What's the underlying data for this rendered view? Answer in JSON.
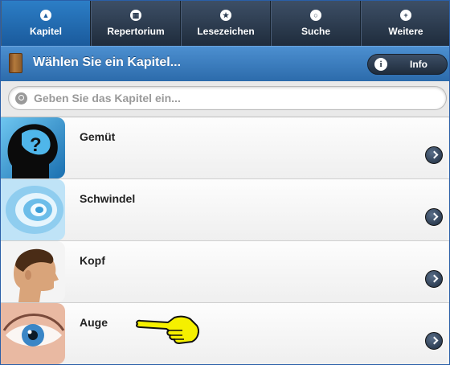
{
  "nav": {
    "tabs": [
      {
        "label": "Kapitel",
        "icon": "book-icon",
        "active": true
      },
      {
        "label": "Repertorium",
        "icon": "grid-icon",
        "active": false
      },
      {
        "label": "Lesezeichen",
        "icon": "star-icon",
        "active": false
      },
      {
        "label": "Suche",
        "icon": "search-icon",
        "active": false
      },
      {
        "label": "Weitere",
        "icon": "plus-icon",
        "active": false
      }
    ]
  },
  "header": {
    "title": "Wählen Sie ein Kapitel...",
    "info_label": "Info"
  },
  "search": {
    "placeholder": "Geben Sie das Kapitel ein..."
  },
  "chapters": [
    {
      "label": "Gemüt"
    },
    {
      "label": "Schwindel"
    },
    {
      "label": "Kopf"
    },
    {
      "label": "Auge"
    }
  ],
  "colors": {
    "nav_dark": "#1f2c3c",
    "nav_active": "#1a5a9c",
    "header_blue": "#2c6bab",
    "pointer_yellow": "#f5f000"
  }
}
